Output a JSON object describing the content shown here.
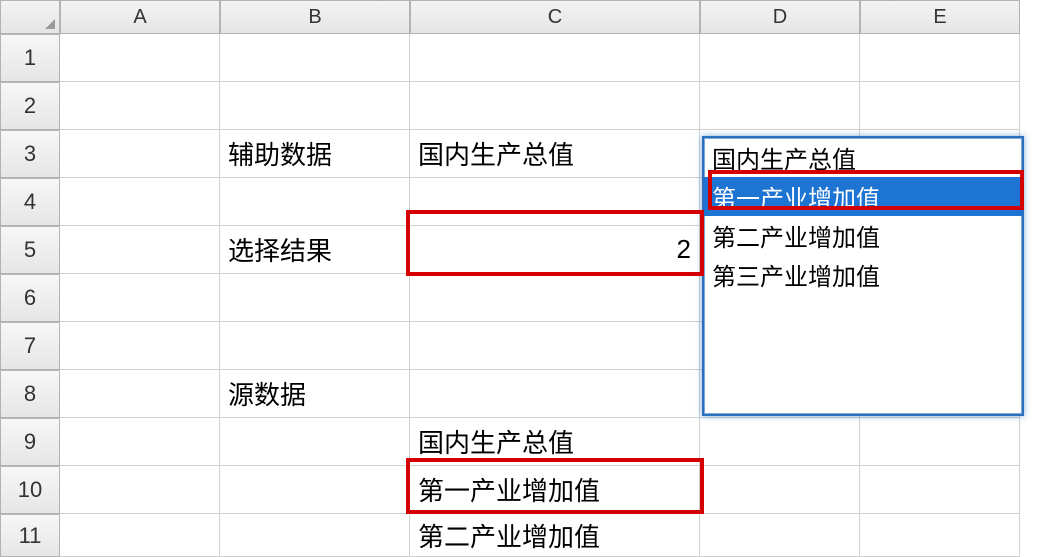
{
  "columns": [
    "A",
    "B",
    "C",
    "D",
    "E"
  ],
  "rows": [
    "1",
    "2",
    "3",
    "4",
    "5",
    "6",
    "7",
    "8",
    "9",
    "10",
    "11"
  ],
  "cells": {
    "B3": "辅助数据",
    "C3": "国内生产总值",
    "B5": "选择结果",
    "C5": "2",
    "B8": "源数据",
    "C9": "国内生产总值",
    "C10": "第一产业增加值",
    "C11": "第二产业增加值"
  },
  "dropdown": {
    "items": [
      "国内生产总值",
      "第一产业增加值",
      "第二产业增加值",
      "第三产业增加值"
    ],
    "selected_index": 1
  }
}
